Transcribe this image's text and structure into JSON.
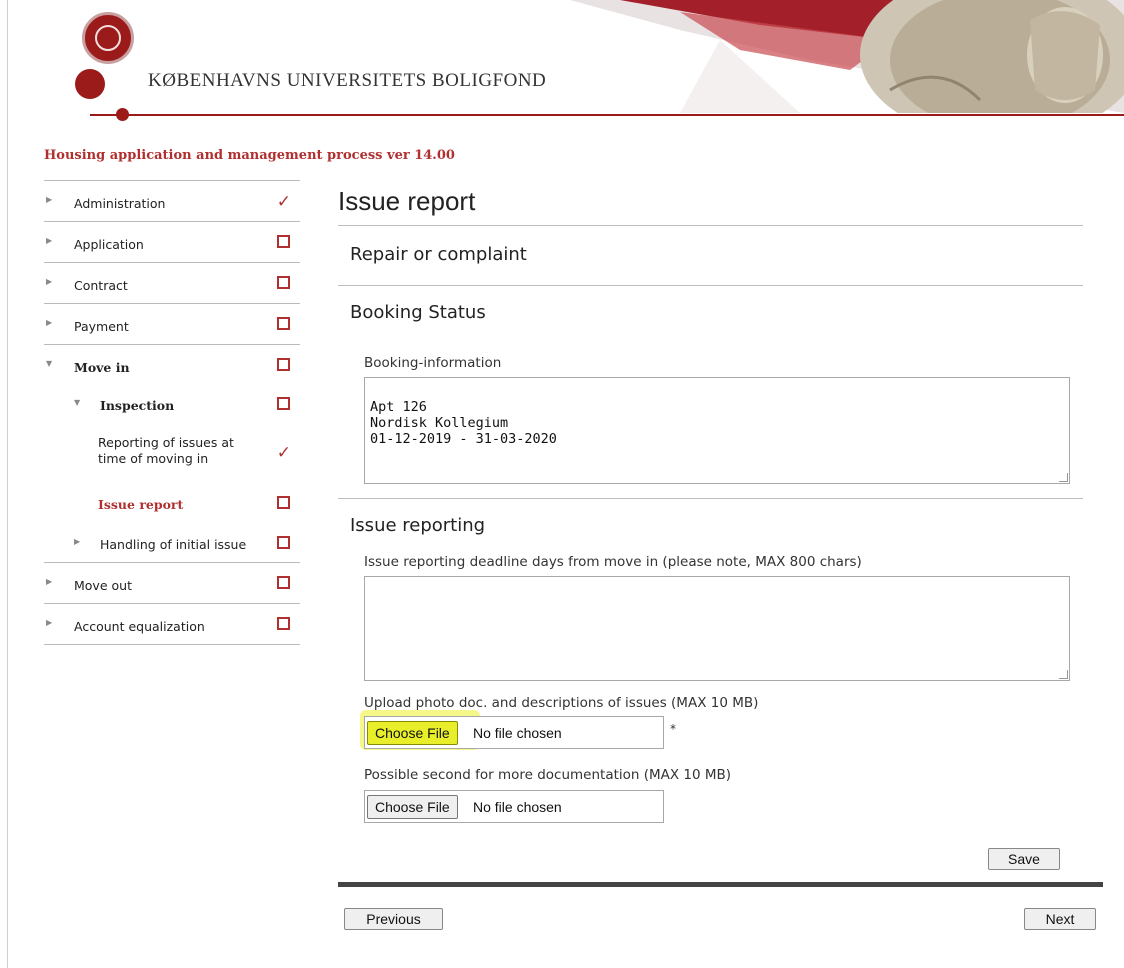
{
  "header": {
    "brand": "KØBENHAVNS UNIVERSITETS BOLIGFOND",
    "subtitle": "Housing application and management process ver 14.00"
  },
  "colors": {
    "accent": "#9b1b1b",
    "link_active": "#b03030",
    "highlight": "#e8ef2a"
  },
  "sidebar": {
    "items": [
      {
        "label": "Administration",
        "status": "checked",
        "icon": "checkmark-icon"
      },
      {
        "label": "Application",
        "status": "unchecked",
        "icon": "checkbox-icon"
      },
      {
        "label": "Contract",
        "status": "unchecked",
        "icon": "checkbox-icon"
      },
      {
        "label": "Payment",
        "status": "unchecked",
        "icon": "checkbox-icon"
      },
      {
        "label": "Move in",
        "status": "unchecked",
        "icon": "checkbox-icon",
        "expanded": true
      },
      {
        "label": "Inspection",
        "status": "unchecked",
        "icon": "checkbox-icon",
        "expanded": true
      },
      {
        "label": "Reporting of issues at time of moving in",
        "status": "checked",
        "icon": "checkmark-icon"
      },
      {
        "label": "Issue report",
        "status": "unchecked",
        "icon": "checkbox-icon",
        "active": true
      },
      {
        "label": "Handling of initial issue",
        "status": "unchecked",
        "icon": "checkbox-icon"
      },
      {
        "label": "Move out",
        "status": "unchecked",
        "icon": "checkbox-icon"
      },
      {
        "label": "Account equalization",
        "status": "unchecked",
        "icon": "checkbox-icon"
      }
    ]
  },
  "main": {
    "title": "Issue report",
    "section_repair": "Repair or complaint",
    "section_booking": "Booking Status",
    "booking_label": "Booking-information",
    "booking_value": "Apt 126\nNordisk Kollegium\n01-12-2019 - 31-03-2020",
    "section_issue": "Issue reporting",
    "issue_label": "Issue reporting deadline days from move in (please note, MAX 800 chars)",
    "issue_value": "",
    "upload1_label": "Upload photo doc. and descriptions of issues (MAX 10 MB)",
    "upload1_button": "Choose File",
    "upload1_status": "No file chosen",
    "upload1_required": "*",
    "upload2_label": "Possible second for more documentation (MAX 10 MB)",
    "upload2_button": "Choose File",
    "upload2_status": "No file chosen",
    "save_label": "Save",
    "previous_label": "Previous",
    "next_label": "Next"
  }
}
